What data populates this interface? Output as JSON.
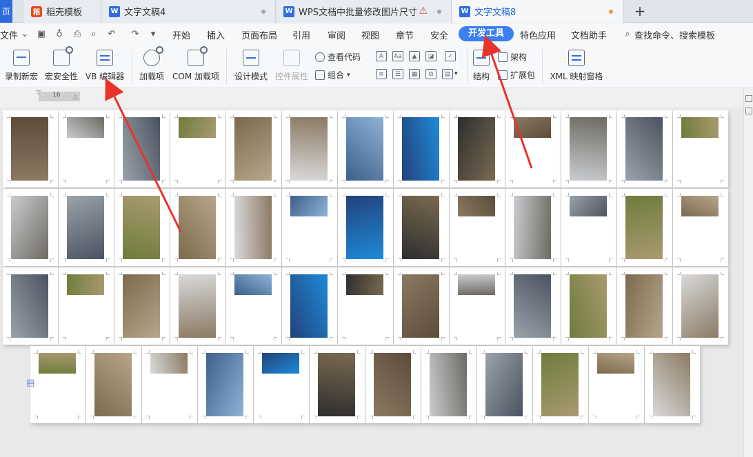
{
  "tabs": [
    {
      "name": "tab-home-edge",
      "label": "页"
    },
    {
      "name": "tab-daoke",
      "label": "稻壳模板",
      "icon": "daoke-logo-icon"
    },
    {
      "name": "tab-doc4",
      "label": "文字文稿4",
      "icon": "wps-writer-icon"
    },
    {
      "name": "tab-batch-resize",
      "label": "WPS文档中批量修改图片尺寸",
      "icon": "wps-writer-icon",
      "warning": true
    },
    {
      "name": "tab-doc8",
      "label": "文字文稿8",
      "icon": "wps-writer-icon",
      "active": true,
      "unsaved": true
    }
  ],
  "menu": {
    "file": "文件",
    "items": [
      "开始",
      "插入",
      "页面布局",
      "引用",
      "审阅",
      "视图",
      "章节",
      "安全",
      "开发工具",
      "特色应用",
      "文档助手"
    ],
    "active_item": "开发工具",
    "search": "查找命令、搜索模板"
  },
  "ribbon": {
    "record_macro": "录制新宏",
    "macro_security": "宏安全性",
    "vb_editor": "VB 编辑器",
    "addins": "加载项",
    "com_addins": "COM 加载项",
    "design_mode": "设计模式",
    "control_props": "控件属性",
    "view_code": "查看代码",
    "group": "组合",
    "structure": "结构",
    "schema": "架构",
    "expansion_pack": "扩展包",
    "xml_mapping": "XML 映射窗格",
    "control_glyph_text": "A",
    "control_glyph_aa": "Aa"
  },
  "ruler": {
    "value": "16"
  },
  "thumbnails": {
    "total_pages": 52,
    "rows": [
      {
        "pages": 13,
        "note": "row 1"
      },
      {
        "pages": 13,
        "note": "row 2"
      },
      {
        "pages": 13,
        "note": "row 3"
      },
      {
        "pages": 12,
        "note": "row 4"
      }
    ]
  },
  "colors": {
    "accent": "#3b7ff0",
    "arrow": "#e8322a",
    "tab_bar": "#dfe3ea",
    "canvas": "#e9e9e9"
  }
}
